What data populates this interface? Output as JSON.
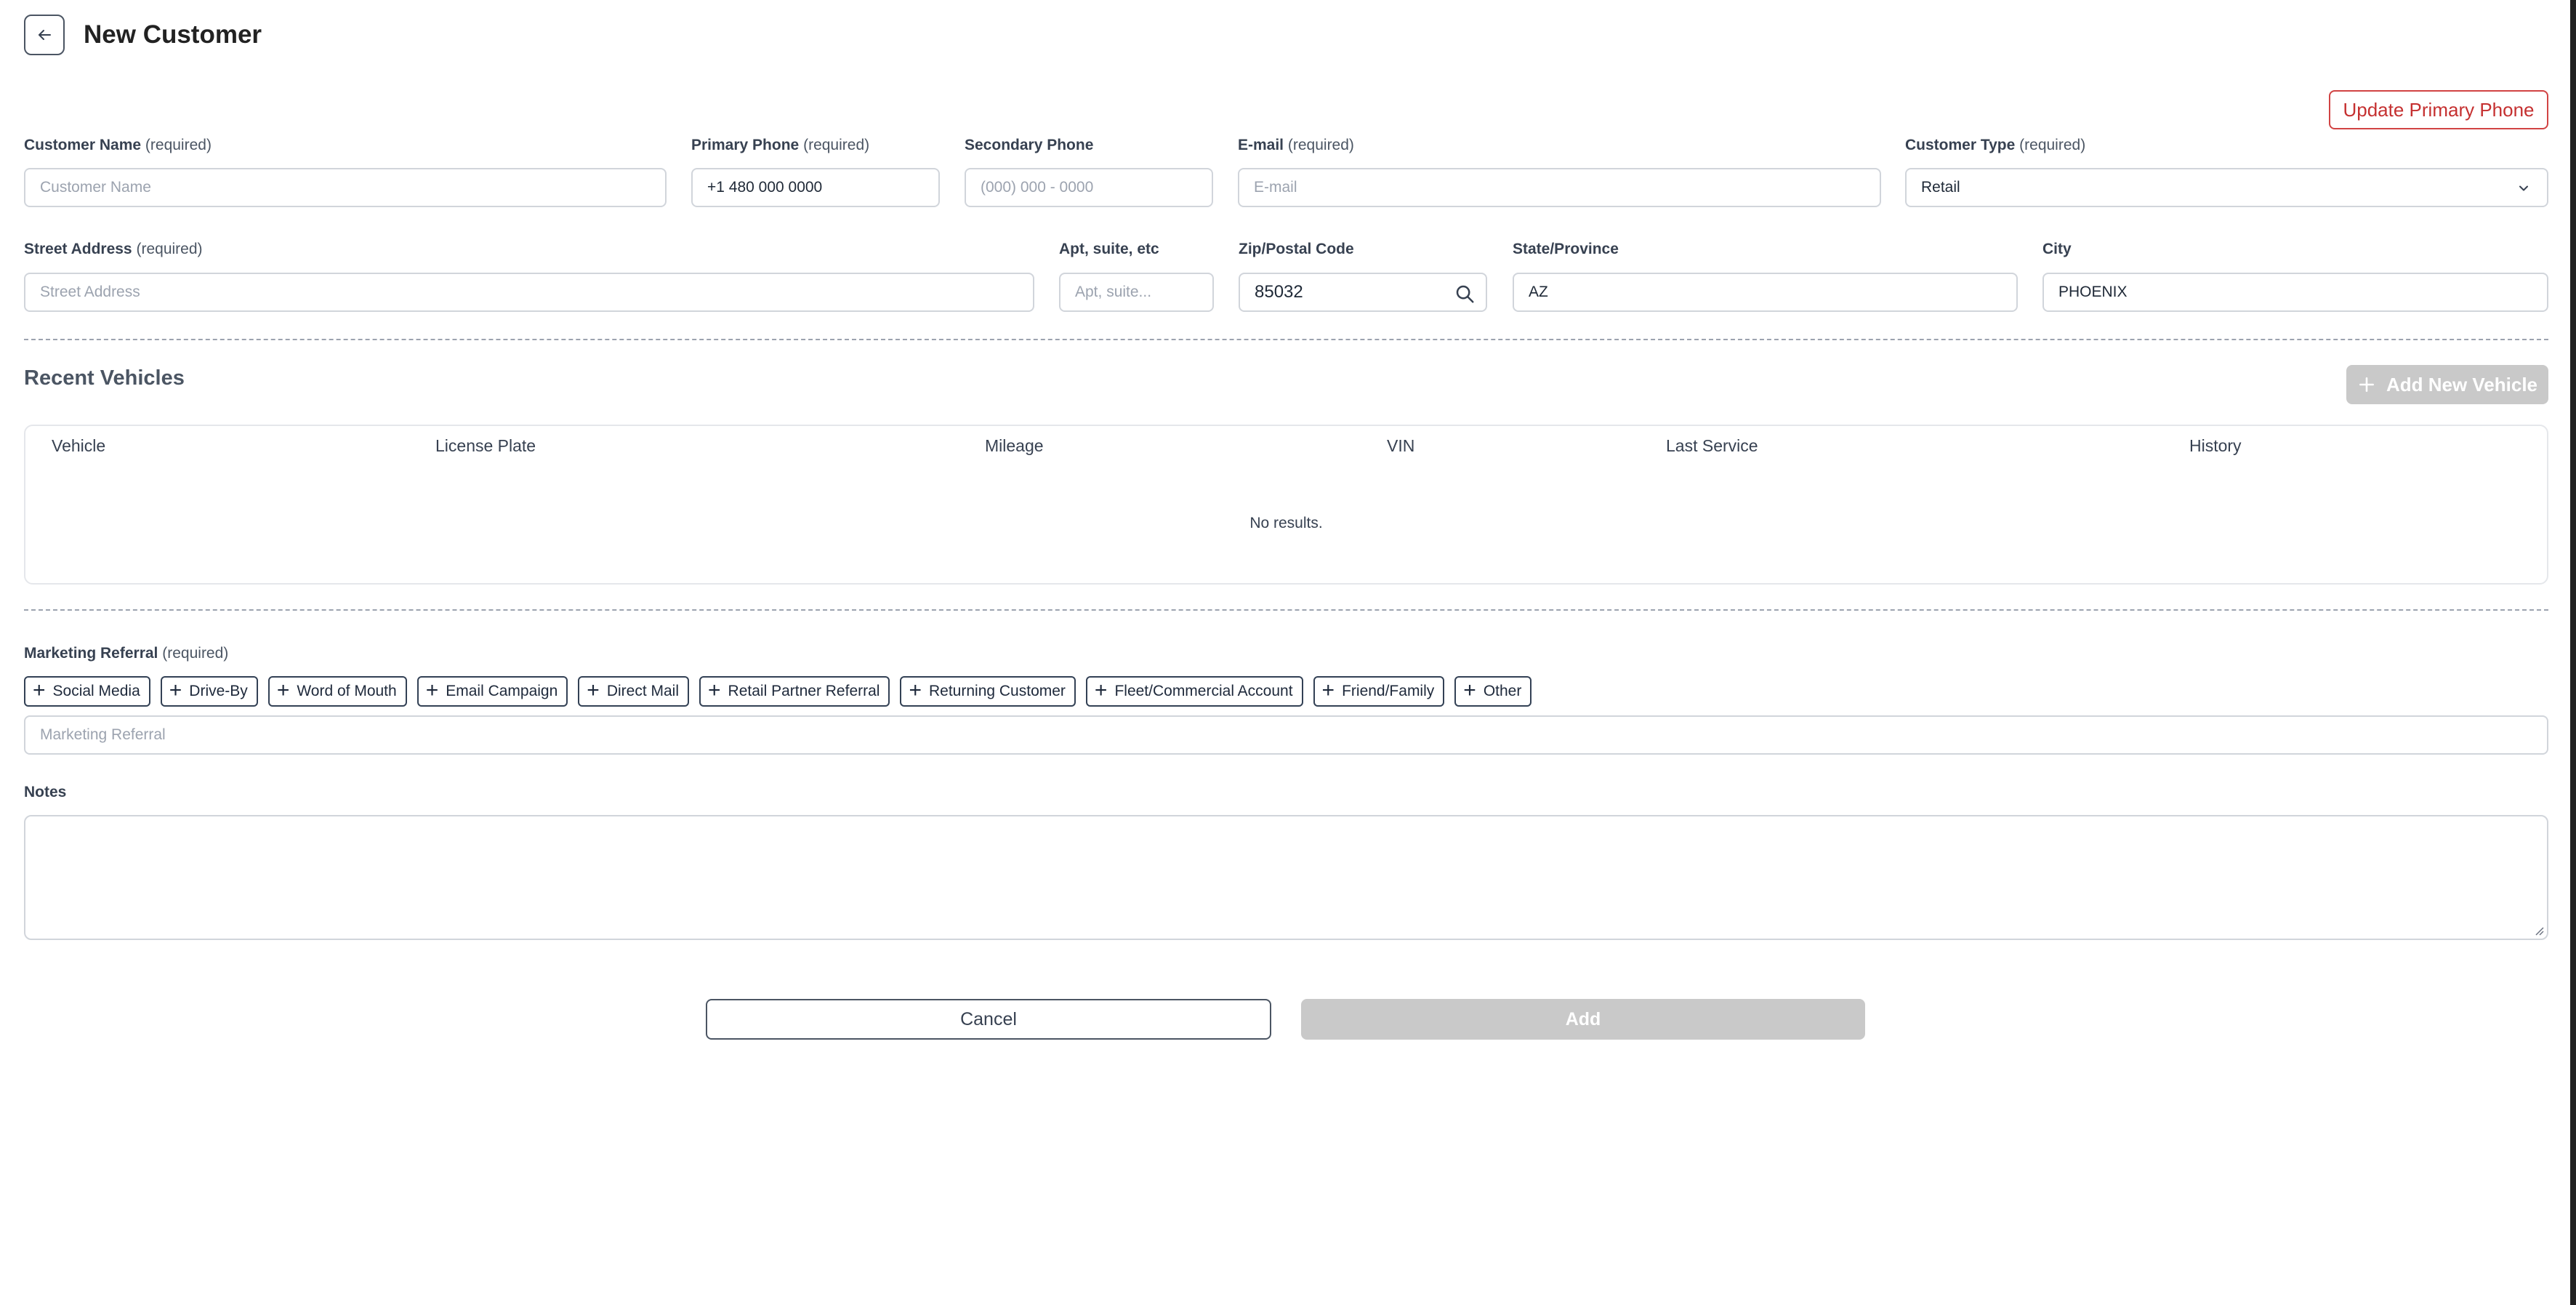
{
  "header": {
    "title": "New Customer"
  },
  "actions": {
    "update_phone": "Update Primary Phone"
  },
  "fields": {
    "customer_name": {
      "label": "Customer Name",
      "req": "(required)",
      "placeholder": "Customer Name"
    },
    "primary_phone": {
      "label": "Primary Phone",
      "req": "(required)",
      "value": "+1 480 000 0000"
    },
    "secondary_phone": {
      "label": "Secondary Phone",
      "placeholder": "(000) 000 - 0000"
    },
    "email": {
      "label": "E-mail",
      "req": "(required)",
      "placeholder": "E-mail"
    },
    "customer_type": {
      "label": "Customer Type",
      "req": "(required)",
      "value": "Retail"
    },
    "street": {
      "label": "Street Address",
      "req": "(required)",
      "placeholder": "Street Address"
    },
    "apt": {
      "label": "Apt, suite, etc",
      "placeholder": "Apt, suite..."
    },
    "zip": {
      "label": "Zip/Postal Code",
      "value": "85032"
    },
    "state": {
      "label": "State/Province",
      "value": "AZ"
    },
    "city": {
      "label": "City",
      "value": "PHOENIX"
    }
  },
  "vehicles": {
    "title": "Recent Vehicles",
    "add_label": "Add New Vehicle",
    "columns": [
      "Vehicle",
      "License Plate",
      "Mileage",
      "VIN",
      "Last Service",
      "History"
    ],
    "empty": "No results."
  },
  "marketing": {
    "label": "Marketing Referral",
    "req": "(required)",
    "chips": [
      "Social Media",
      "Drive-By",
      "Word of Mouth",
      "Email Campaign",
      "Direct Mail",
      "Retail Partner Referral",
      "Returning Customer",
      "Fleet/Commercial Account",
      "Friend/Family",
      "Other"
    ],
    "placeholder": "Marketing Referral"
  },
  "notes": {
    "label": "Notes"
  },
  "footer": {
    "cancel": "Cancel",
    "add": "Add"
  },
  "colors": {
    "danger": "#c53030",
    "disabled": "#c9c9c9",
    "chip_border": "#334155"
  }
}
